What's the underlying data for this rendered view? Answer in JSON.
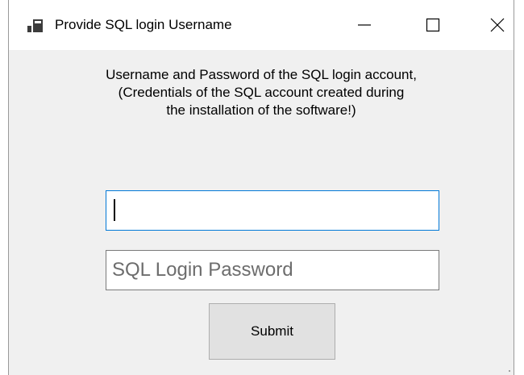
{
  "window": {
    "title": "Provide SQL login Username",
    "controls": {
      "minimize_icon": "minimize-icon",
      "maximize_icon": "maximize-icon",
      "close_icon": "close-icon"
    }
  },
  "form": {
    "description_lines": [
      "Username and Password of the SQL login account,",
      "(Credentials of the SQL account created during",
      "the installation of the software!)"
    ],
    "username": {
      "value": "",
      "placeholder": ""
    },
    "password": {
      "value": "",
      "placeholder": "SQL Login Password"
    },
    "submit_label": "Submit"
  },
  "colors": {
    "focus_border": "#0078d7",
    "window_background": "#f0f0f0",
    "button_background": "#e1e1e1"
  }
}
